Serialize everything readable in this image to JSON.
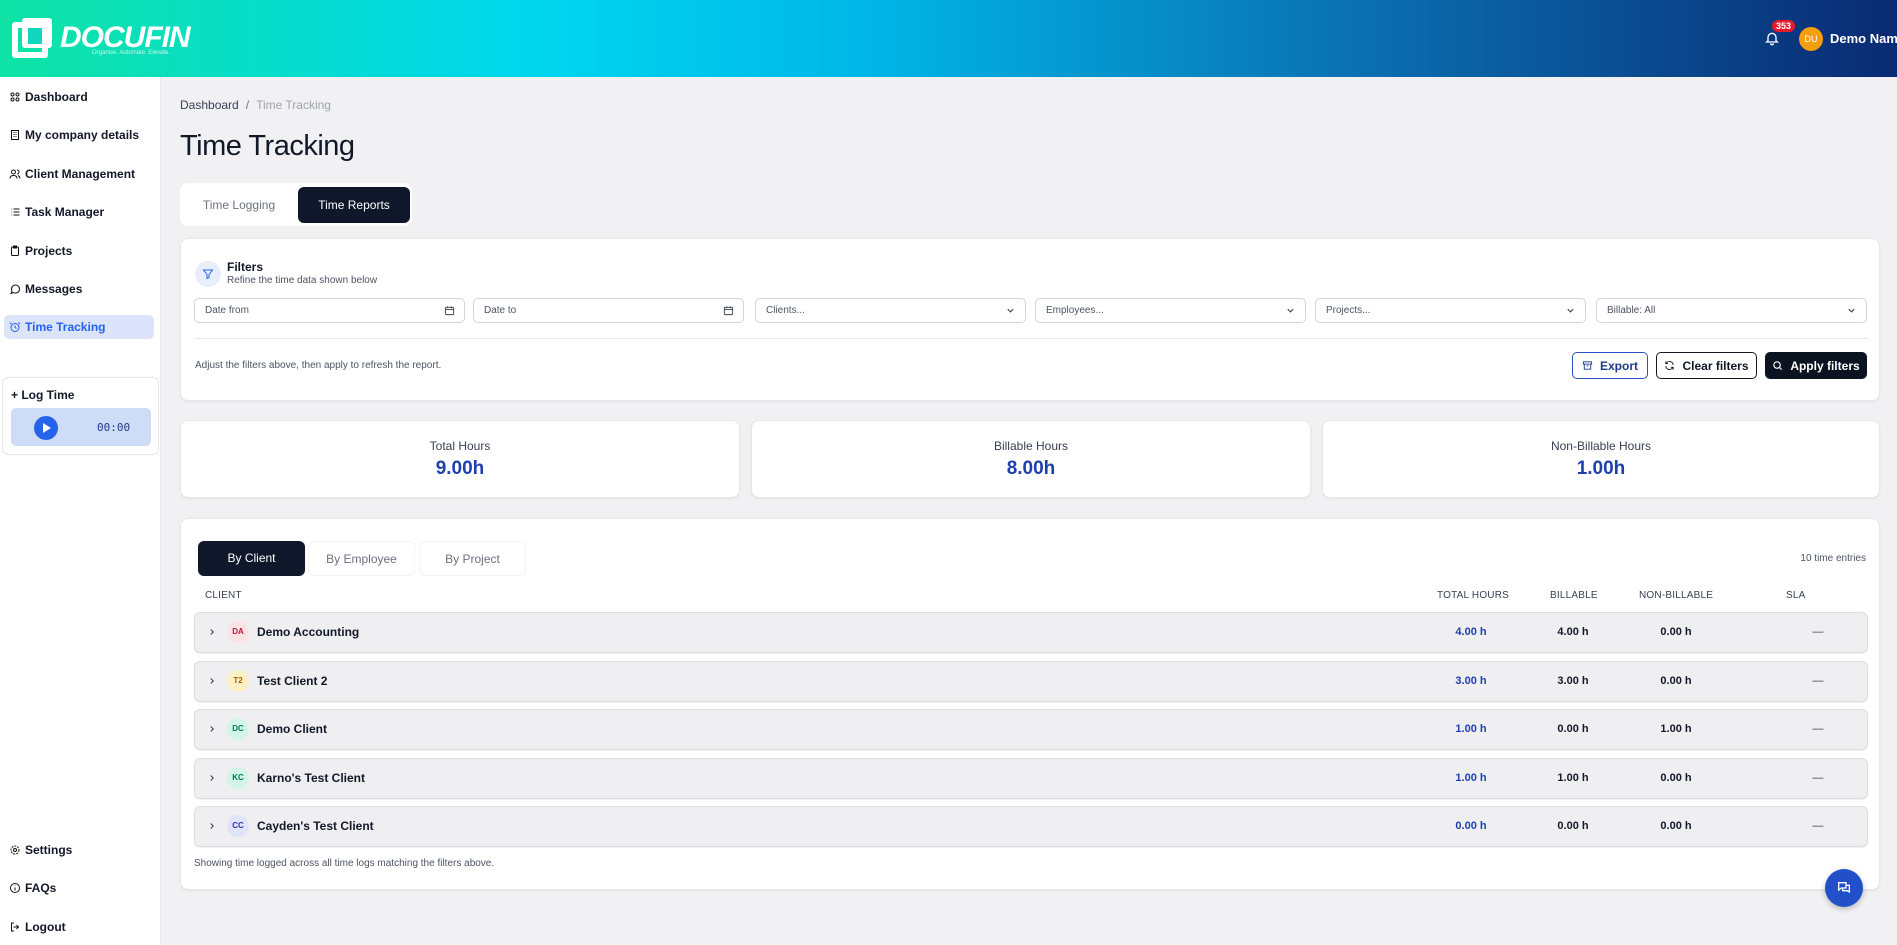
{
  "header": {
    "logo_text": "DOCUFIN",
    "logo_tagline": "Organise. Automate. Elevate.",
    "notification_count": "353",
    "user_initials": "DU",
    "user_name": "Demo Name"
  },
  "sidebar": {
    "items": [
      {
        "label": "Dashboard",
        "icon": "grid-icon"
      },
      {
        "label": "My company details",
        "icon": "building-icon"
      },
      {
        "label": "Client Management",
        "icon": "users-icon"
      },
      {
        "label": "Task Manager",
        "icon": "list-icon"
      },
      {
        "label": "Projects",
        "icon": "clipboard-icon"
      },
      {
        "label": "Messages",
        "icon": "message-icon"
      },
      {
        "label": "Time Tracking",
        "icon": "clock-icon",
        "active": true
      }
    ],
    "log_time": {
      "label": "+ Log Time",
      "timer": "00:00"
    },
    "bottom_items": [
      {
        "label": "Settings",
        "icon": "gear-icon"
      },
      {
        "label": "FAQs",
        "icon": "info-icon"
      },
      {
        "label": "Logout",
        "icon": "logout-icon"
      }
    ]
  },
  "breadcrumb": {
    "root": "Dashboard",
    "separator": "/",
    "current": "Time Tracking"
  },
  "page_title": "Time Tracking",
  "tabs": [
    {
      "label": "Time Logging",
      "active": false
    },
    {
      "label": "Time Reports",
      "active": true
    }
  ],
  "filters": {
    "title": "Filters",
    "subtitle": "Refine the time data shown below",
    "date_from": "Date from",
    "date_to": "Date to",
    "clients": "Clients...",
    "employees": "Employees...",
    "projects": "Projects...",
    "billable": "Billable: All",
    "note": "Adjust the filters above, then apply to refresh the report.",
    "export_label": "Export",
    "clear_label": "Clear filters",
    "apply_label": "Apply filters"
  },
  "stats": [
    {
      "label": "Total Hours",
      "value": "9.00h"
    },
    {
      "label": "Billable Hours",
      "value": "8.00h"
    },
    {
      "label": "Non-Billable Hours",
      "value": "1.00h"
    }
  ],
  "report": {
    "tabs": [
      {
        "label": "By Client",
        "active": true
      },
      {
        "label": "By Employee",
        "active": false
      },
      {
        "label": "By Project",
        "active": false
      }
    ],
    "entries_count": "10 time entries",
    "columns": {
      "client": "Client",
      "total": "Total Hours",
      "billable": "Billable",
      "non_billable": "Non-Billable",
      "sla": "SLA"
    },
    "rows": [
      {
        "initials": "DA",
        "name": "Demo Accounting",
        "total": "4.00 h",
        "billable": "4.00 h",
        "non_billable": "0.00 h",
        "sla": "—",
        "badge_bg": "#fde2e4",
        "badge_fg": "#be123c"
      },
      {
        "initials": "T2",
        "name": "Test Client 2",
        "total": "3.00 h",
        "billable": "3.00 h",
        "non_billable": "0.00 h",
        "sla": "—",
        "badge_bg": "#fdf0c4",
        "badge_fg": "#a16207"
      },
      {
        "initials": "DC",
        "name": "Demo Client",
        "total": "1.00 h",
        "billable": "0.00 h",
        "non_billable": "1.00 h",
        "sla": "—",
        "badge_bg": "#d1f5e6",
        "badge_fg": "#047857"
      },
      {
        "initials": "KC",
        "name": "Karno's Test Client",
        "total": "1.00 h",
        "billable": "1.00 h",
        "non_billable": "0.00 h",
        "sla": "—",
        "badge_bg": "#d1f5e6",
        "badge_fg": "#047857"
      },
      {
        "initials": "CC",
        "name": "Cayden's Test Client",
        "total": "0.00 h",
        "billable": "0.00 h",
        "non_billable": "0.00 h",
        "sla": "—",
        "badge_bg": "#e0e4fb",
        "badge_fg": "#3730a3"
      }
    ],
    "note": "Showing time logged across all time logs matching the filters above."
  },
  "colors": {
    "accent": "#2563eb",
    "dark": "#0f172a",
    "value_blue": "#1e40af"
  }
}
